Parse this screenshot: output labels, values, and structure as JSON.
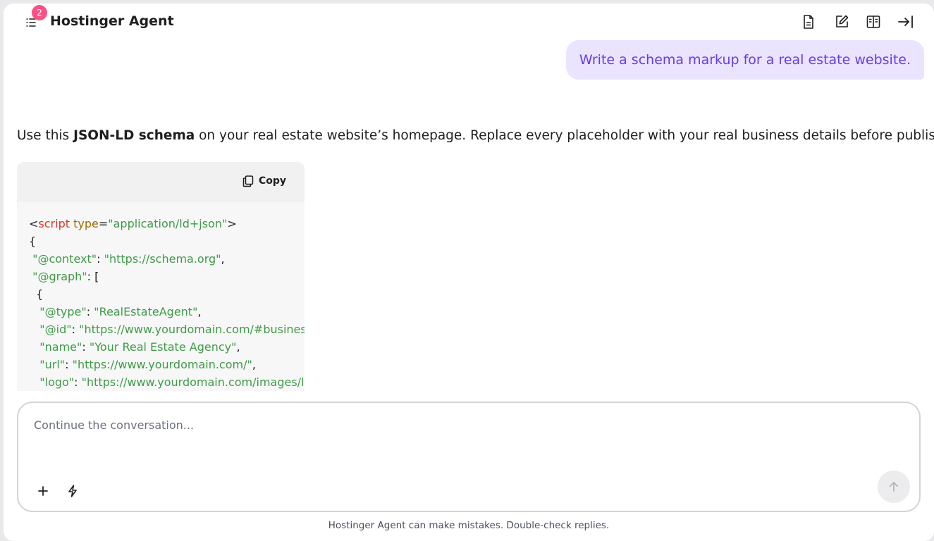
{
  "header": {
    "title": "Hostinger Agent",
    "notification_count": "2",
    "icons": [
      "menu-icon",
      "document-icon",
      "edit-icon",
      "book-icon",
      "arrow-to-right-icon"
    ]
  },
  "conversation": {
    "user_message": "Write a schema markup for a real estate website.",
    "assistant_intro_before": "Use this ",
    "assistant_intro_bold": "JSON-LD schema",
    "assistant_intro_after": " on your real estate website’s homepage. Replace every placeholder with your real business details before publishing.",
    "code_block": {
      "copy_label": "Copy",
      "lines": [
        [
          {
            "t": "punc",
            "v": "<"
          },
          {
            "t": "tag",
            "v": "script"
          },
          {
            "t": "punc",
            "v": " "
          },
          {
            "t": "attr",
            "v": "type"
          },
          {
            "t": "punc",
            "v": "="
          },
          {
            "t": "str",
            "v": "\"application/ld+json\""
          },
          {
            "t": "punc",
            "v": ">"
          }
        ],
        [
          {
            "t": "punc",
            "v": "{"
          }
        ],
        [
          {
            "t": "punc",
            "v": " "
          },
          {
            "t": "str",
            "v": "\"@context\""
          },
          {
            "t": "punc",
            "v": ": "
          },
          {
            "t": "str",
            "v": "\"https://schema.org\""
          },
          {
            "t": "punc",
            "v": ","
          }
        ],
        [
          {
            "t": "punc",
            "v": " "
          },
          {
            "t": "str",
            "v": "\"@graph\""
          },
          {
            "t": "punc",
            "v": ": ["
          }
        ],
        [
          {
            "t": "punc",
            "v": "  {"
          }
        ],
        [
          {
            "t": "punc",
            "v": "   "
          },
          {
            "t": "str",
            "v": "\"@type\""
          },
          {
            "t": "punc",
            "v": ": "
          },
          {
            "t": "str",
            "v": "\"RealEstateAgent\""
          },
          {
            "t": "punc",
            "v": ","
          }
        ],
        [
          {
            "t": "punc",
            "v": "   "
          },
          {
            "t": "str",
            "v": "\"@id\""
          },
          {
            "t": "punc",
            "v": ": "
          },
          {
            "t": "str",
            "v": "\"https://www.yourdomain.com/#business\""
          },
          {
            "t": "punc",
            "v": ","
          }
        ],
        [
          {
            "t": "punc",
            "v": "   "
          },
          {
            "t": "str",
            "v": "\"name\""
          },
          {
            "t": "punc",
            "v": ": "
          },
          {
            "t": "str",
            "v": "\"Your Real Estate Agency\""
          },
          {
            "t": "punc",
            "v": ","
          }
        ],
        [
          {
            "t": "punc",
            "v": "   "
          },
          {
            "t": "str",
            "v": "\"url\""
          },
          {
            "t": "punc",
            "v": ": "
          },
          {
            "t": "str",
            "v": "\"https://www.yourdomain.com/\""
          },
          {
            "t": "punc",
            "v": ","
          }
        ],
        [
          {
            "t": "punc",
            "v": "   "
          },
          {
            "t": "str",
            "v": "\"logo\""
          },
          {
            "t": "punc",
            "v": ": "
          },
          {
            "t": "str",
            "v": "\"https://www.yourdomain.com/images/logo.png\""
          },
          {
            "t": "punc",
            "v": ","
          }
        ]
      ]
    }
  },
  "composer": {
    "placeholder": "Continue the conversation...",
    "value": "",
    "tools": [
      "plus-icon",
      "lightning-icon"
    ],
    "send_icon": "arrow-up-icon"
  },
  "footer": {
    "disclaimer": "Hostinger Agent can make mistakes. Double-check replies."
  }
}
